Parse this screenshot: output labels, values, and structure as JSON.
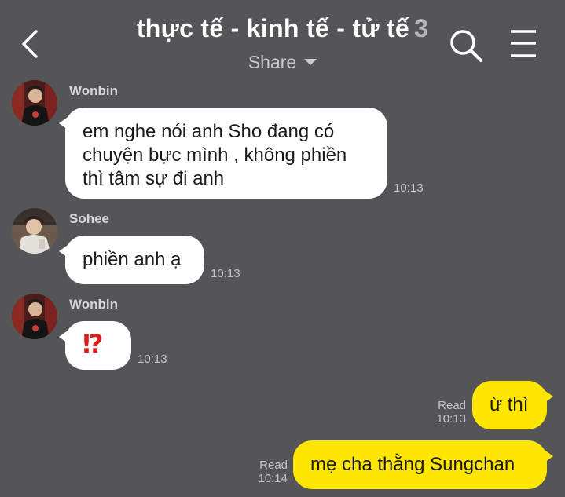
{
  "header": {
    "title": "thực tế - kinh tế - tử tế",
    "member_count": "3",
    "subtitle": "Share"
  },
  "icons": {
    "back": "chevron-left-icon",
    "search": "search-icon",
    "menu": "menu-icon",
    "dropdown": "caret-down-icon"
  },
  "colors": {
    "background": "#555558",
    "incoming_bubble": "#ffffff",
    "outgoing_bubble": "#ffe600",
    "emoji": "#d81e1e"
  },
  "messages": [
    {
      "sender": "Wonbin",
      "text": "em nghe nói anh Sho đang có chuyện bực mình , không phiền thì tâm sự đi anh",
      "time": "10:13"
    },
    {
      "sender": "Sohee",
      "text": "phiền anh ạ",
      "time": "10:13"
    },
    {
      "sender": "Wonbin",
      "text": "⁉",
      "time": "10:13"
    },
    {
      "sender": "me",
      "text": "ừ thì",
      "status": "Read",
      "time": "10:13"
    },
    {
      "sender": "me",
      "text": "mẹ cha thằng Sungchan",
      "status": "Read",
      "time": "10:14"
    }
  ]
}
